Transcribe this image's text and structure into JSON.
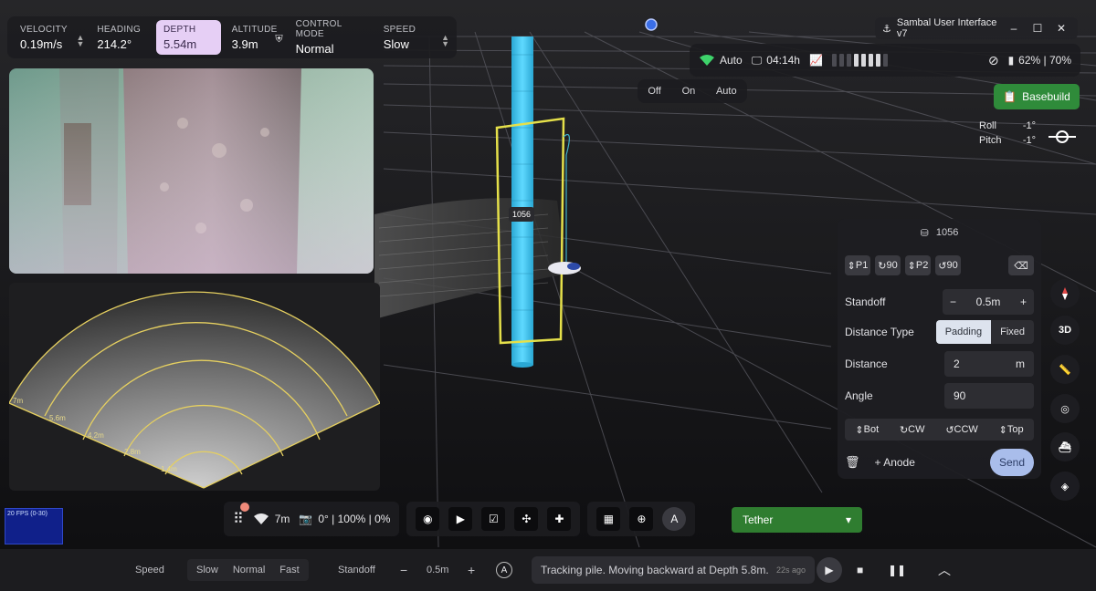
{
  "window": {
    "title": "Sambal User Interface v7"
  },
  "telemetry": [
    {
      "label": "VELOCITY",
      "value": "0.19m/s"
    },
    {
      "label": "HEADING",
      "value": "214.2°"
    },
    {
      "label": "DEPTH",
      "value": "5.54m"
    },
    {
      "label": "ALTITUDE",
      "value": "3.9m"
    },
    {
      "label": "CONTROL MODE",
      "value": "Normal"
    },
    {
      "label": "SPEED",
      "value": "Slow"
    }
  ],
  "status": {
    "wifi": "Auto",
    "time": "04:14h",
    "battery": "62% | 70%"
  },
  "mode_toggle": {
    "off": "Off",
    "on": "On",
    "auto": "Auto"
  },
  "basebuild": "Basebuild",
  "attitude": {
    "roll_label": "Roll",
    "roll_value": "-1°",
    "pitch_label": "Pitch",
    "pitch_value": "-1°"
  },
  "scene": {
    "pile_tag": "1056"
  },
  "sonar_labels": [
    "7m",
    "5.6m",
    "4.2m",
    "2.8m",
    "1.4m"
  ],
  "fps": "20 FPS (0-30)",
  "nav_panel": {
    "title": "1056",
    "waypoints": [
      "P1",
      "90",
      "P2",
      "90"
    ],
    "standoff": {
      "label": "Standoff",
      "value": "0.5m"
    },
    "distance_type": {
      "label": "Distance Type",
      "options": [
        "Padding",
        "Fixed"
      ]
    },
    "distance": {
      "label": "Distance",
      "value": "2",
      "unit": "m"
    },
    "angle": {
      "label": "Angle",
      "value": "90"
    },
    "moves": [
      "Bot",
      "CW",
      "CCW",
      "Top"
    ],
    "add_anode": "+ Anode",
    "send": "Send"
  },
  "side_tools": [
    "compass-icon",
    "3D",
    "ruler-icon",
    "target-icon",
    "vehicle-icon",
    "layers-icon"
  ],
  "toolbar": {
    "range": "7m",
    "camera": "0° | 100% | 0%",
    "tether": "Tether"
  },
  "bottom": {
    "speed_label": "Speed",
    "speeds": [
      "Slow",
      "Normal",
      "Fast"
    ],
    "standoff_label": "Standoff",
    "standoff_value": "0.5m",
    "message": "Tracking pile. Moving backward at Depth 5.8m.",
    "message_time": "22s ago"
  }
}
